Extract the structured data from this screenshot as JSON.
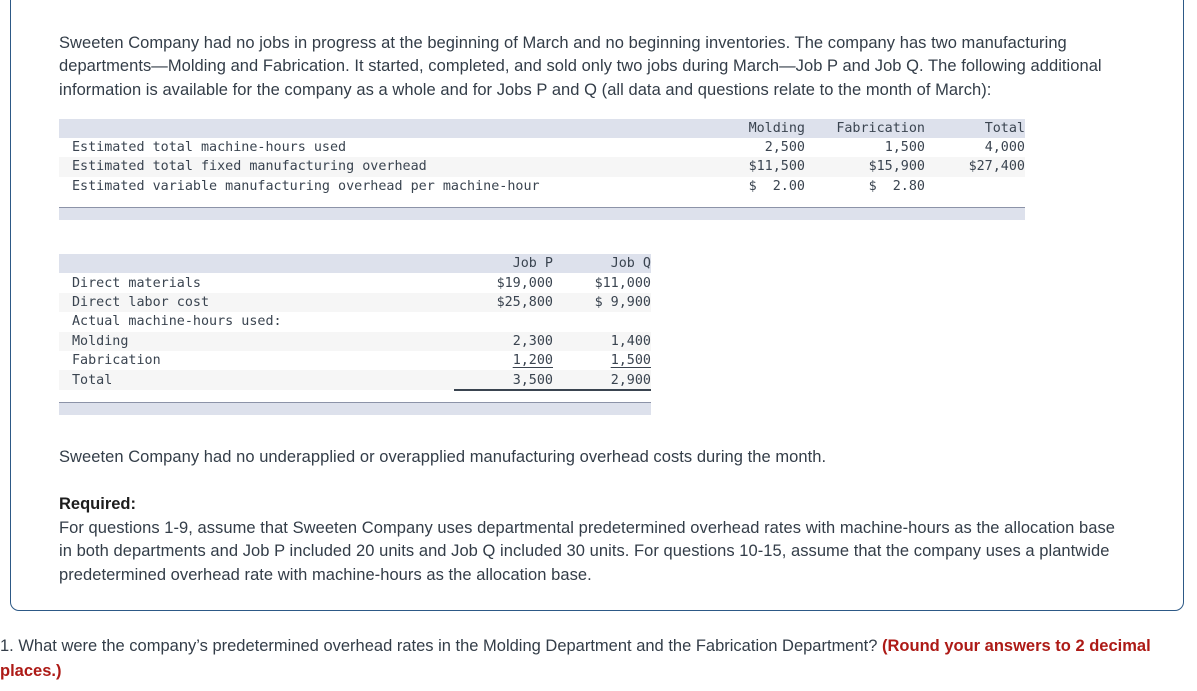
{
  "problem": {
    "intro": "Sweeten Company had no jobs in progress at the beginning of March and no beginning inventories. The company has two manufacturing departments—Molding and Fabrication. It started, completed, and sold only two jobs during March—Job P and Job Q. The following additional information is available for the company as a whole and for Jobs P and Q (all data and questions relate to the month of March):",
    "no_over_under": "Sweeten Company had no underapplied or overapplied manufacturing overhead costs during the month.",
    "required_label": "Required:",
    "required_body": "For questions 1-9, assume that Sweeten Company uses departmental predetermined overhead rates with machine-hours as the allocation base in both departments and Job P included 20 units and Job Q included 30 units. For questions 10-15, assume that the company uses a plantwide predetermined overhead rate with machine-hours as the allocation base."
  },
  "estimates_table": {
    "columns": [
      "",
      "Molding",
      "Fabrication",
      "Total"
    ],
    "rows": [
      {
        "label": "Estimated total machine-hours used",
        "molding": "2,500",
        "fabrication": "1,500",
        "total": "4,000"
      },
      {
        "label": "Estimated total fixed manufacturing overhead",
        "molding": "$11,500",
        "fabrication": "$15,900",
        "total": "$27,400"
      },
      {
        "label": "Estimated variable manufacturing overhead per machine-hour",
        "molding": "$  2.00",
        "fabrication": "$  2.80",
        "total": ""
      }
    ]
  },
  "jobs_table": {
    "columns": [
      "",
      "Job P",
      "Job Q"
    ],
    "rows": [
      {
        "label": "Direct materials",
        "job_p": "$19,000",
        "job_q": "$11,000",
        "rule": "none"
      },
      {
        "label": "Direct labor cost",
        "job_p": "$25,800",
        "job_q": "$ 9,900",
        "rule": "none"
      },
      {
        "label": "Actual machine-hours used:",
        "job_p": "",
        "job_q": "",
        "rule": "none"
      },
      {
        "label": "Molding",
        "job_p": "2,300",
        "job_q": "1,400",
        "rule": "none"
      },
      {
        "label": "Fabrication",
        "job_p": "1,200",
        "job_q": "1,500",
        "rule": "single"
      },
      {
        "label": "Total",
        "job_p": "3,500",
        "job_q": "2,900",
        "rule": "double"
      }
    ]
  },
  "question": {
    "number_and_text": "1. What were the company’s predetermined overhead rates in the Molding Department and the Fabrication Department? ",
    "emphasis": "(Round your answers to 2 decimal places.)"
  },
  "colors": {
    "card_border": "#2d5986",
    "table_header_band": "#dde1ec",
    "table_alt_row": "#f6f6f6",
    "emphasis_red": "#ad1a16",
    "body_text": "#333d48"
  }
}
